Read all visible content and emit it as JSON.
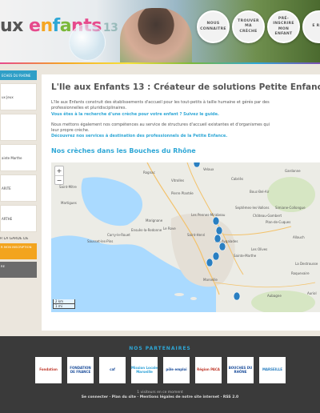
{
  "header": {
    "logo_main": "ux ",
    "logo_word": [
      "e",
      "n",
      "f",
      "a",
      "nts"
    ],
    "logo_num": "13",
    "nav": [
      {
        "label": "NOUS CONNAITRE"
      },
      {
        "label": "TROUVER MA CRÈCHE"
      },
      {
        "label": "PRÉ-INSCRIRE MON ENFANT"
      },
      {
        "label": "E REC"
      }
    ]
  },
  "sidebar": {
    "head": "ECHES DU RHONE",
    "items": [
      "ux Jeux",
      "",
      "ainte Marthe",
      "ARITE",
      "ARTHE"
    ],
    "plain": "R LA GARDE DE",
    "orange": "R MON INSCRIPTION",
    "grey": "RE"
  },
  "main": {
    "title": "L'Ile aux Enfants 13 : Créateur de solutions Petite Enfance",
    "p1_line1": "L'Ile aux Enfants construit des établissements d'accueil pour les tout-petits à taille humaine et gérés par des",
    "p1_line2": "professionnelles et pluridisciplinaires.",
    "p1_line3": "Vous êtes à la recherche d'une crèche pour votre enfant ? Suivez le guide.",
    "p2_line1": "Nous mettons également nos compétences au service de structures d'accueil existantes et d'organismes qui",
    "p2_line2": "leur propre crèche.",
    "p2_line3": "Découvrez nos services à destination des professionnels de la Petite Enfance.",
    "subtitle": "Nos crèches dans les Bouches du Rhône"
  },
  "map": {
    "zoom_in": "+",
    "zoom_out": "−",
    "scale_km": "2 km",
    "scale_mi": "1 mi",
    "labels": [
      "Martigues",
      "Marignane",
      "Vitrolles",
      "Les Pennes-Mirabeau",
      "Plan-de-Cuques",
      "Allauch",
      "Marseille",
      "Carry-le-Rouet",
      "Sausset-les-Pins",
      "Ensuès-la-Redonne",
      "Le Rove",
      "Rognac",
      "Velaux",
      "Cabriès",
      "Bouc-Bel-Air",
      "Gardanne",
      "Simiane-Collongue",
      "Septèmes-les-Vallons",
      "La Destrousse",
      "Roquevaire",
      "Aubagne",
      "Château-Gombert",
      "Les Olives",
      "Saint-Henri",
      "Les Aygalades",
      "Sainte-Marthe",
      "Saint-Mitre",
      "Pierre Plantée",
      "Auriol"
    ],
    "marker_color": "#2a7fc1"
  },
  "footer": {
    "partners_title": "NOS PARTENAIRES",
    "partners": [
      {
        "name": "Fondation",
        "color": "#c0392b"
      },
      {
        "name": "FONDATION DE FRANCE",
        "color": "#1d4f9c"
      },
      {
        "name": "caf",
        "color": "#1d4f9c"
      },
      {
        "name": "Mission Locale Marseille",
        "color": "#2a9fd6"
      },
      {
        "name": "pôle emploi",
        "color": "#1d4f9c"
      },
      {
        "name": "Région PACA",
        "color": "#c0392b"
      },
      {
        "name": "BOUCHES DU RHÔNE",
        "color": "#1d4f9c"
      },
      {
        "name": "MARSEILLE",
        "color": "#2a7fc1"
      }
    ],
    "visitors": "1 visiteurs en ce moment",
    "links": "Se connecter · Plan du site · Mentions légales de notre site internet · RSS 2.0"
  }
}
